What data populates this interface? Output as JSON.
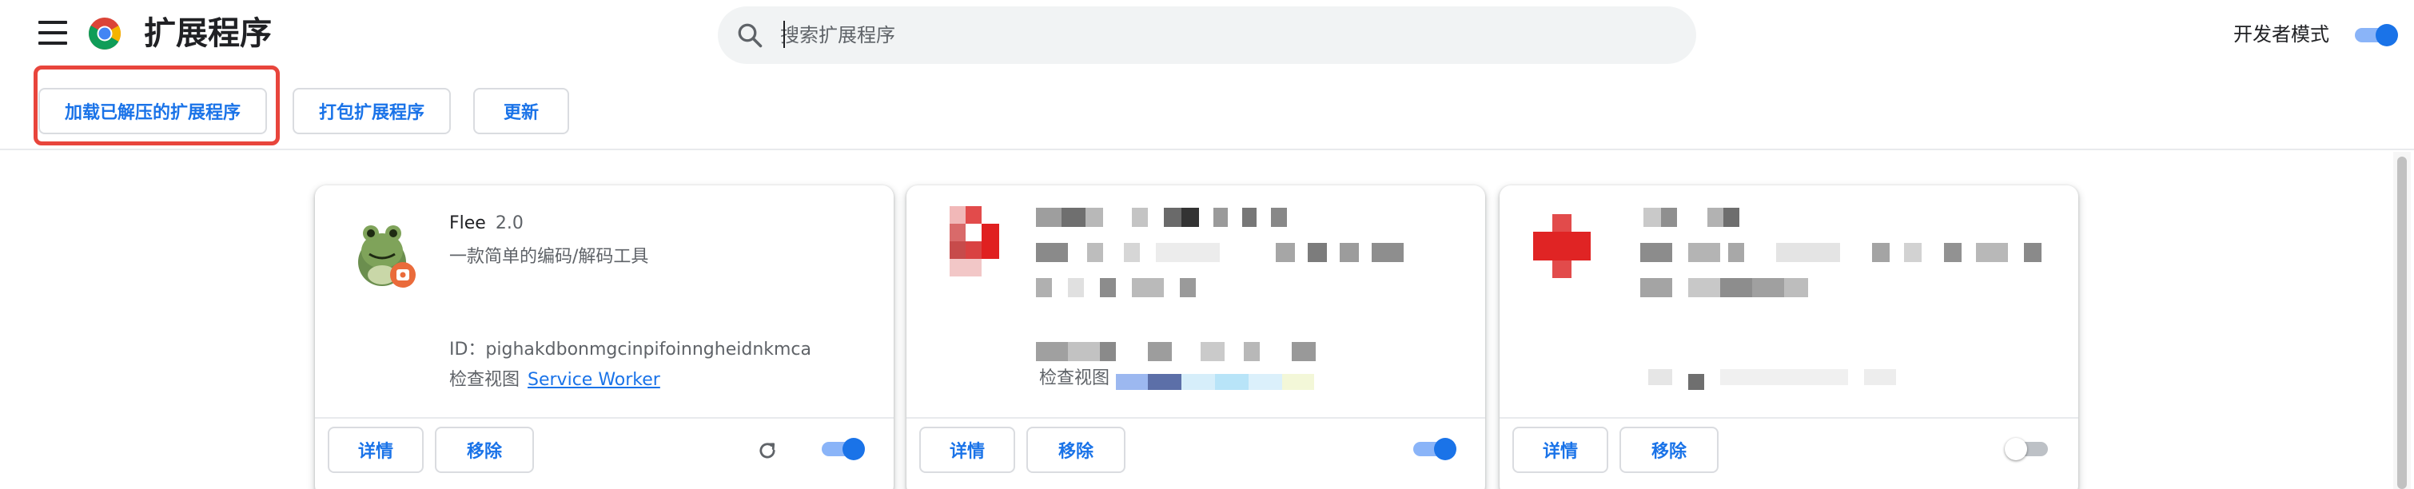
{
  "header": {
    "title": "扩展程序",
    "search_placeholder": "搜索扩展程序",
    "dev_mode_label": "开发者模式",
    "dev_mode_on": true
  },
  "toolbar": {
    "load_unpacked": "加载已解压的扩展程序",
    "pack": "打包扩展程序",
    "update": "更新"
  },
  "colors": {
    "accent": "#1a73e8",
    "highlight": "#e8453c"
  },
  "cards": [
    {
      "name": "Flee",
      "version": "2.0",
      "description": "一款简单的编码/解码工具",
      "id_text": "ID：pighakdbonmgcinpifoinngheidnkmca",
      "inspect_label": "检查视图",
      "inspect_link": "Service Worker",
      "details": "详情",
      "remove": "移除",
      "enabled": true,
      "icon": "frog-extension-icon"
    },
    {
      "inspect_label": "检查视图",
      "details": "详情",
      "remove": "移除",
      "enabled": true,
      "icon": "red-square-icon"
    },
    {
      "details": "详情",
      "remove": "移除",
      "enabled": false,
      "icon": "red-cross-icon"
    }
  ]
}
